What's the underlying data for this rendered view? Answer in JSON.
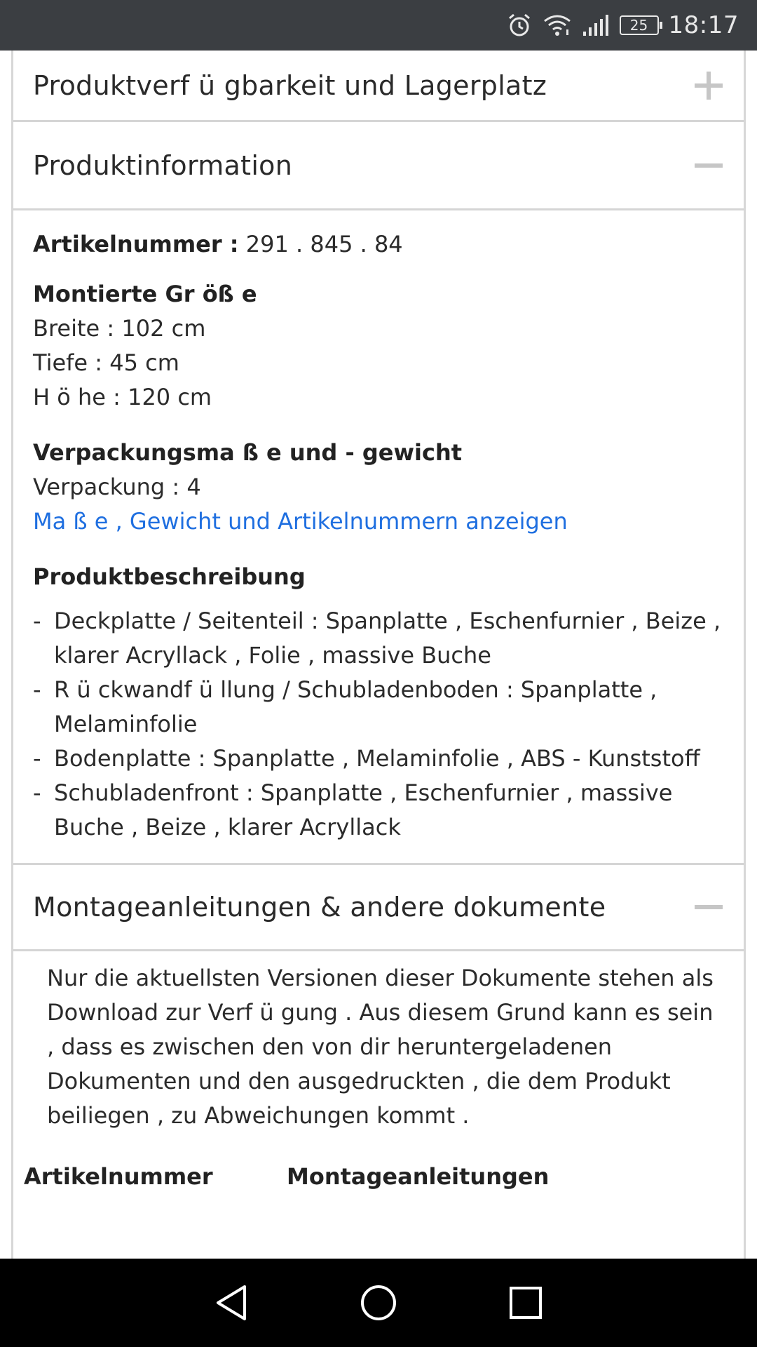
{
  "status": {
    "time": "18:17",
    "battery": "25",
    "icons": [
      "alarm-icon",
      "wifi-icon",
      "signal-icon",
      "battery-icon"
    ]
  },
  "sections": {
    "availability": {
      "title": "Produktverf ü gbarkeit und Lagerplatz",
      "state": "collapsed"
    },
    "info": {
      "title": "Produktinformation",
      "state": "expanded"
    },
    "docs": {
      "title": "Montageanleitungen & andere dokumente",
      "state": "expanded"
    }
  },
  "product": {
    "article_label": "Artikelnummer :",
    "article_number": "291 . 845 . 84",
    "assembled_heading": "Montierte Gr öß e",
    "width": "Breite : 102 cm",
    "depth": "Tiefe : 45 cm",
    "height": "H ö he : 120 cm",
    "packaging_heading": "Verpackungsma ß e und - gewicht",
    "packaging": "Verpackung : 4",
    "packaging_link": "Ma ß e , Gewicht und Artikelnummern anzeigen",
    "description_heading": "Produktbeschreibung",
    "description": [
      "Deckplatte / Seitenteil : Spanplatte , Eschenfurnier , Beize , klarer Acryllack , Folie , massive Buche",
      "R ü ckwandf ü llung / Schubladenboden : Spanplatte , Melaminfolie",
      "Bodenplatte : Spanplatte , Melaminfolie , ABS - Kunststoff",
      "Schubladenfront : Spanplatte , Eschenfurnier , massive Buche , Beize , klarer Acryllack"
    ]
  },
  "docs": {
    "note": "Nur die aktuellsten Versionen dieser Dokumente stehen als Download zur Verf ü gung . Aus diesem Grund kann es sein , dass es zwischen den von dir heruntergeladenen Dokumenten und den ausgedruckten , die dem Produkt beiliegen , zu Abweichungen kommt .",
    "col_article": "Artikelnummer",
    "col_manuals": "Montageanleitungen"
  },
  "navbar": {
    "icons": [
      "back-icon",
      "home-icon",
      "recents-icon"
    ]
  }
}
